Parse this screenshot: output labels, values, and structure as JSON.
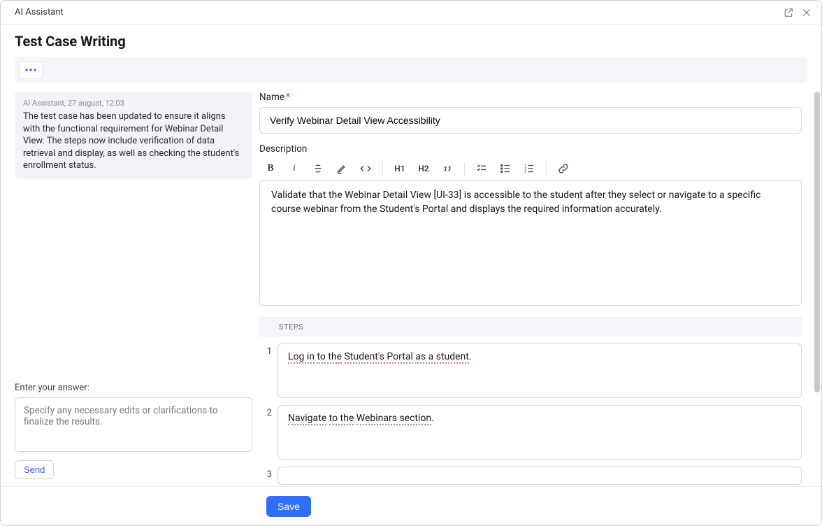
{
  "app": {
    "title": "AI Assistant"
  },
  "page": {
    "title": "Test Case Writing"
  },
  "chat": {
    "meta": "AI Assistant, 27 august, 12:03",
    "body": "The test case has been updated to ensure it aligns with the functional requirement for Webinar Detail View. The steps now include verification of data retrieval and display, as well as checking the student's enrollment status."
  },
  "answer": {
    "label": "Enter your answer:",
    "placeholder": "Specify any necessary edits or clarifications to finalize the results.",
    "send_label": "Send"
  },
  "form": {
    "name_label": "Name",
    "name_required": "*",
    "name_value": "Verify Webinar Detail View Accessibility",
    "desc_label": "Description",
    "desc_value": "Validate that the Webinar Detail View [UI-33] is accessible to the student after they select or navigate to a specific course webinar from the Student's Portal and displays the required information accurately.",
    "steps_header": "STEPS",
    "steps": [
      {
        "num": "1",
        "parts": [
          {
            "text": "Log in",
            "u": true
          },
          {
            "text": " "
          },
          {
            "text": "to the",
            "u": true
          },
          {
            "text": " "
          },
          {
            "text": "Student's Portal",
            "u": true
          },
          {
            "text": " "
          },
          {
            "text": "as a student",
            "u": true
          },
          {
            "text": "."
          }
        ]
      },
      {
        "num": "2",
        "parts": [
          {
            "text": "Navigate",
            "u": true
          },
          {
            "text": " "
          },
          {
            "text": "to the",
            "u": true
          },
          {
            "text": " "
          },
          {
            "text": "Webinars section",
            "u": true
          },
          {
            "text": "."
          }
        ]
      },
      {
        "num": "3",
        "parts": []
      }
    ],
    "save_label": "Save"
  },
  "toolbar": {
    "h1": "H1",
    "h2": "H2"
  }
}
